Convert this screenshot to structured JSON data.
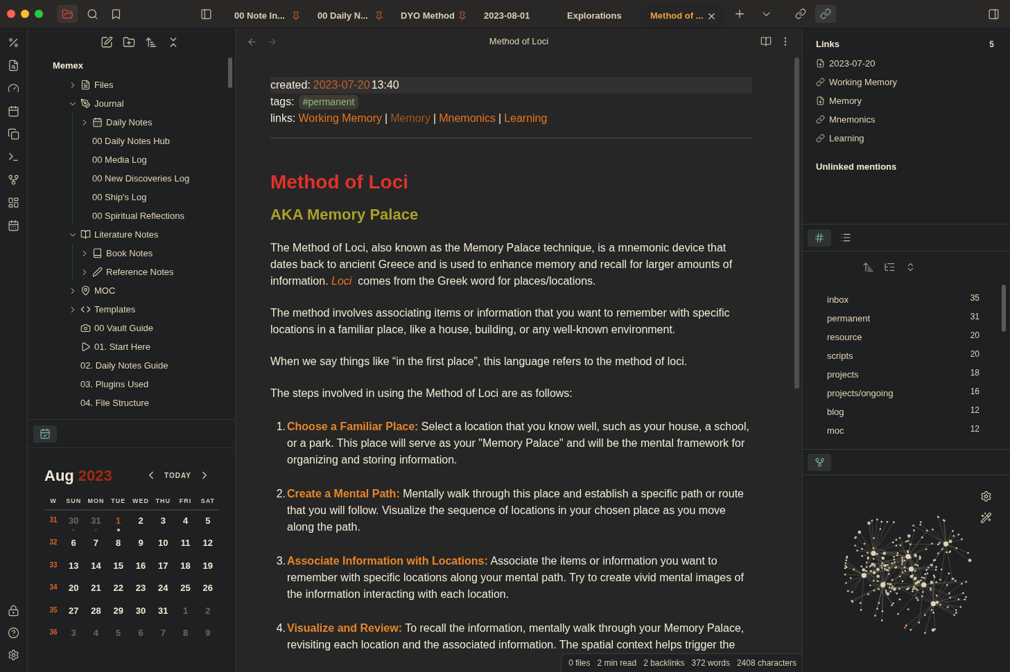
{
  "top_bar": {
    "tabs": [
      {
        "label": "00 Note In...",
        "pinned": true,
        "selected": false
      },
      {
        "label": "00 Daily N...",
        "pinned": true,
        "selected": false
      },
      {
        "label": "DYO Method",
        "pinned": true,
        "selected": false
      },
      {
        "label": "2023-08-01",
        "pinned": false,
        "selected": false
      },
      {
        "label": "Explorations",
        "pinned": false,
        "selected": false
      },
      {
        "label": "Method of ...",
        "pinned": false,
        "selected": true
      }
    ]
  },
  "file_explorer": {
    "vault": "Memex",
    "tree": [
      {
        "label": "Files",
        "expanded": false
      },
      {
        "label": "Journal",
        "expanded": true,
        "children": [
          {
            "label": "Daily Notes",
            "expanded": false
          },
          {
            "label": "00 Daily Notes Hub"
          },
          {
            "label": "00 Media Log"
          },
          {
            "label": "00 New Discoveries Log"
          },
          {
            "label": "00 Ship's Log"
          },
          {
            "label": "00 Spiritual Reflections"
          }
        ]
      },
      {
        "label": "Literature Notes",
        "expanded": true,
        "children": [
          {
            "label": "Book Notes",
            "expanded": false
          },
          {
            "label": "Reference Notes",
            "expanded": false
          }
        ]
      },
      {
        "label": "MOC",
        "expanded": false
      },
      {
        "label": "Templates",
        "expanded": false
      },
      {
        "label": "00 Vault Guide"
      },
      {
        "label": "01. Start Here"
      },
      {
        "label": "02. Daily Notes Guide"
      },
      {
        "label": "03. Plugins Used"
      },
      {
        "label": "04. File Structure"
      }
    ]
  },
  "calendar": {
    "month": "Aug",
    "year": "2023",
    "today_button": "TODAY",
    "weekdays": [
      "W",
      "SUN",
      "MON",
      "TUE",
      "WED",
      "THU",
      "FRI",
      "SAT"
    ],
    "weeks": [
      {
        "week": "31",
        "days": [
          {
            "day": "30",
            "outside": true,
            "dot": true,
            "today": false
          },
          {
            "day": "31",
            "outside": true,
            "dot": true,
            "today": false
          },
          {
            "day": "1",
            "outside": false,
            "dot": true,
            "today": true
          },
          {
            "day": "2",
            "outside": false,
            "dot": false,
            "today": false
          },
          {
            "day": "3",
            "outside": false,
            "dot": false,
            "today": false
          },
          {
            "day": "4",
            "outside": false,
            "dot": false,
            "today": false
          },
          {
            "day": "5",
            "outside": false,
            "dot": false,
            "today": false
          }
        ]
      },
      {
        "week": "32",
        "days": [
          {
            "day": "6",
            "outside": false,
            "dot": false,
            "today": false
          },
          {
            "day": "7",
            "outside": false,
            "dot": false,
            "today": false
          },
          {
            "day": "8",
            "outside": false,
            "dot": false,
            "today": false
          },
          {
            "day": "9",
            "outside": false,
            "dot": false,
            "today": false
          },
          {
            "day": "10",
            "outside": false,
            "dot": false,
            "today": false
          },
          {
            "day": "11",
            "outside": false,
            "dot": false,
            "today": false
          },
          {
            "day": "12",
            "outside": false,
            "dot": false,
            "today": false
          }
        ]
      },
      {
        "week": "33",
        "days": [
          {
            "day": "13",
            "outside": false,
            "dot": false,
            "today": false
          },
          {
            "day": "14",
            "outside": false,
            "dot": false,
            "today": false
          },
          {
            "day": "15",
            "outside": false,
            "dot": false,
            "today": false
          },
          {
            "day": "16",
            "outside": false,
            "dot": false,
            "today": false
          },
          {
            "day": "17",
            "outside": false,
            "dot": false,
            "today": false
          },
          {
            "day": "18",
            "outside": false,
            "dot": false,
            "today": false
          },
          {
            "day": "19",
            "outside": false,
            "dot": false,
            "today": false
          }
        ]
      },
      {
        "week": "34",
        "days": [
          {
            "day": "20",
            "outside": false,
            "dot": false,
            "today": false
          },
          {
            "day": "21",
            "outside": false,
            "dot": false,
            "today": false
          },
          {
            "day": "22",
            "outside": false,
            "dot": false,
            "today": false
          },
          {
            "day": "23",
            "outside": false,
            "dot": false,
            "today": false
          },
          {
            "day": "24",
            "outside": false,
            "dot": false,
            "today": false
          },
          {
            "day": "25",
            "outside": false,
            "dot": false,
            "today": false
          },
          {
            "day": "26",
            "outside": false,
            "dot": false,
            "today": false
          }
        ]
      },
      {
        "week": "35",
        "days": [
          {
            "day": "27",
            "outside": false,
            "dot": false,
            "today": false
          },
          {
            "day": "28",
            "outside": false,
            "dot": false,
            "today": false
          },
          {
            "day": "29",
            "outside": false,
            "dot": false,
            "today": false
          },
          {
            "day": "30",
            "outside": false,
            "dot": false,
            "today": false
          },
          {
            "day": "31",
            "outside": false,
            "dot": false,
            "today": false
          },
          {
            "day": "1",
            "outside": true,
            "dot": false,
            "today": false
          },
          {
            "day": "2",
            "outside": true,
            "dot": false,
            "today": false
          }
        ]
      },
      {
        "week": "36",
        "days": [
          {
            "day": "3",
            "outside": true,
            "dot": false,
            "today": false
          },
          {
            "day": "4",
            "outside": true,
            "dot": false,
            "today": false
          },
          {
            "day": "5",
            "outside": true,
            "dot": false,
            "today": false
          },
          {
            "day": "6",
            "outside": true,
            "dot": false,
            "today": false
          },
          {
            "day": "7",
            "outside": true,
            "dot": false,
            "today": false
          },
          {
            "day": "8",
            "outside": true,
            "dot": false,
            "today": false
          },
          {
            "day": "9",
            "outside": true,
            "dot": false,
            "today": false
          }
        ]
      }
    ]
  },
  "note": {
    "title": "Method of Loci",
    "properties": {
      "created_label": "created:",
      "created_date": "2023-07-20",
      "created_time": "13:40",
      "tags_label": "tags:",
      "tags": [
        "#permanent"
      ],
      "links_label": "links:",
      "links": [
        {
          "label": "Working Memory",
          "resolved": true
        },
        {
          "label": "Memory",
          "resolved": false,
          "separator": "|"
        },
        {
          "label": "Mnemonics",
          "resolved": true,
          "separator": "|"
        },
        {
          "label": "Learning",
          "resolved": true,
          "separator": "|"
        }
      ]
    },
    "heading": "Method of Loci",
    "subheading": "AKA Memory Palace",
    "paragraphs": [
      "The Method of Loci, also known as the Memory Palace technique, is a mnemonic device that dates back to ancient Greece and is used to enhance memory and recall for larger amounts of information. *Loci*  comes from the Greek word for places/locations.",
      "The method involves associating items or information that you want to remember with specific locations in a familiar place, like a house, building, or any well-known environment.",
      "When we say things like “in the first place”, this language refers to the method of loci.",
      "The steps involved in using the Method of Loci are as follows:"
    ],
    "steps": [
      {
        "number": "1.",
        "title": "Choose a Familiar Place:",
        "text": "Select a location that you know well, such as your house, a school, or a park. This place will serve as your \"Memory Palace\" and will be the mental framework for organizing and storing information."
      },
      {
        "number": "2.",
        "title": "Create a Mental Path:",
        "text": "Mentally walk through this place and establish a specific path or route that you will follow. Visualize the sequence of locations in your chosen place as you move along the path."
      },
      {
        "number": "3.",
        "title": "Associate Information with Locations:",
        "text": "Associate the items or information you want to remember with specific locations along your mental path. Try to create vivid mental images of the information interacting with each location."
      },
      {
        "number": "4.",
        "title": "Visualize and Review:",
        "text": "To recall the information, mentally walk through your Memory Palace, revisiting each location and the associated information. The spatial context helps trigger the"
      }
    ]
  },
  "links_panel": {
    "title": "Links",
    "count": "5",
    "links": [
      {
        "label": "2023-07-20",
        "kind": "file"
      },
      {
        "label": "Working Memory",
        "kind": "link"
      },
      {
        "label": "Memory",
        "kind": "file"
      },
      {
        "label": "Mnemonics",
        "kind": "link"
      },
      {
        "label": "Learning",
        "kind": "link"
      }
    ],
    "unlinked_title": "Unlinked mentions"
  },
  "tag_pane": {
    "views": [
      {
        "kind": "tags",
        "selected": true
      },
      {
        "kind": "list",
        "selected": false
      }
    ],
    "tags": [
      {
        "name": "inbox",
        "count": "35"
      },
      {
        "name": "permanent",
        "count": "31"
      },
      {
        "name": "resource",
        "count": "20"
      },
      {
        "name": "scripts",
        "count": "20"
      },
      {
        "name": "projects",
        "count": "18"
      },
      {
        "name": "projects/ongoing",
        "count": "16"
      },
      {
        "name": "blog",
        "count": "12"
      },
      {
        "name": "moc",
        "count": "12"
      }
    ]
  },
  "status_bar": [
    "0 files",
    "2 min read",
    "2 backlinks",
    "372 words",
    "2408 characters"
  ]
}
